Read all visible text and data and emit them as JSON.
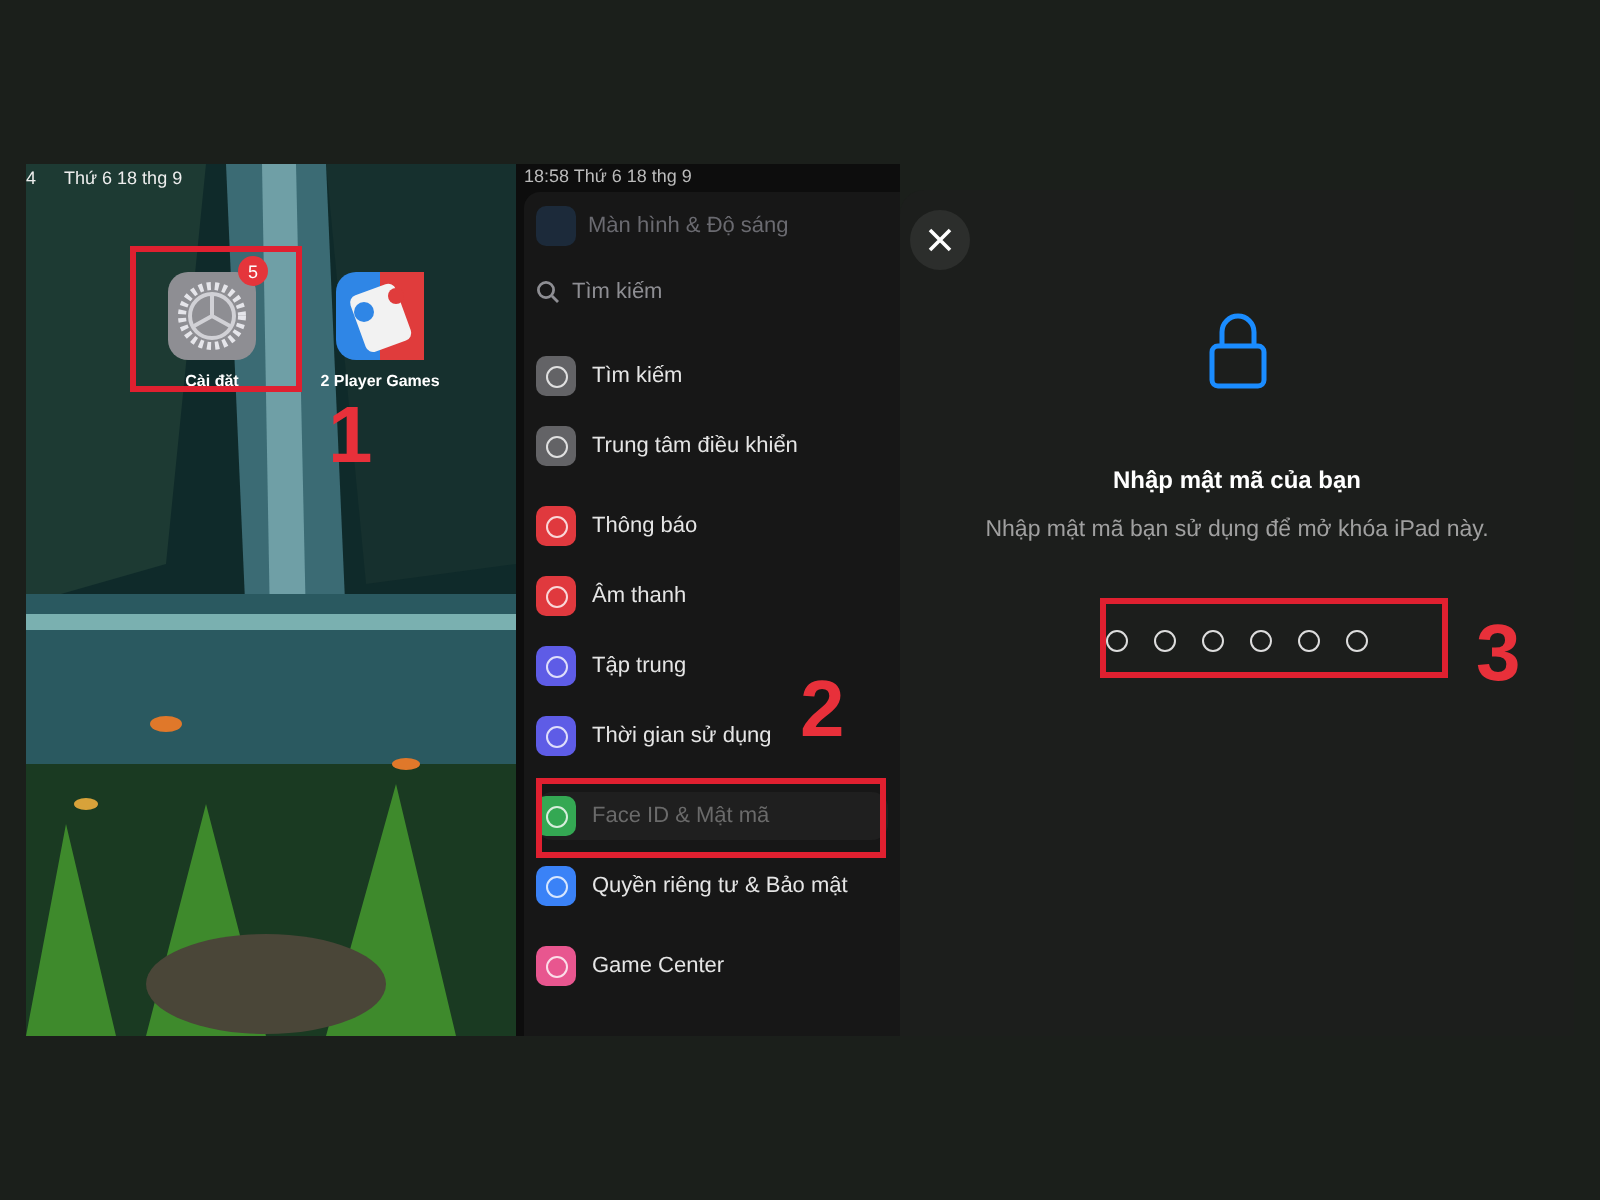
{
  "home_screen": {
    "status_time": "4",
    "status_date": "Thứ 6 18 thg 9",
    "apps": [
      {
        "label": "Cài đặt",
        "badge": "5",
        "kind": "settings"
      },
      {
        "label": "2 Player Games",
        "kind": "game"
      }
    ]
  },
  "settings": {
    "status": "18:58 Thứ 6 18 thg 9",
    "faded_item": "Màn hình & Độ sáng",
    "search": {
      "placeholder": "Tìm kiếm"
    },
    "groups": [
      [
        {
          "label": "Tìm kiếm",
          "color": "#636366",
          "selected": false
        },
        {
          "label": "Trung tâm điều khiển",
          "color": "#636366",
          "selected": false
        }
      ],
      [
        {
          "label": "Thông báo",
          "color": "#e0393e",
          "selected": false
        },
        {
          "label": "Âm thanh",
          "color": "#e0393e",
          "selected": false
        },
        {
          "label": "Tập trung",
          "color": "#5e5ce6",
          "selected": false
        },
        {
          "label": "Thời gian sử dụng",
          "color": "#5e5ce6",
          "selected": false
        }
      ],
      [
        {
          "label": "Face ID & Mật mã",
          "color": "#34a853",
          "selected": true
        },
        {
          "label": "Quyền riêng tư & Bảo mật",
          "color": "#3a82f7",
          "selected": false
        }
      ],
      [
        {
          "label": "Game Center",
          "color": "#e8568f",
          "selected": false
        }
      ]
    ]
  },
  "passcode": {
    "title": "Nhập mật mã của bạn",
    "subtitle": "Nhập mật mã bạn sử dụng để mở khóa iPad này.",
    "digits": [
      {
        "filled": false
      },
      {
        "filled": false
      },
      {
        "filled": false
      },
      {
        "filled": false
      },
      {
        "filled": false
      },
      {
        "filled": false
      }
    ]
  },
  "annotations": [
    "1",
    "2",
    "3"
  ]
}
